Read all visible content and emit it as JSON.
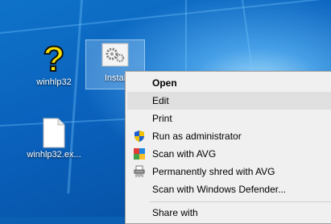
{
  "desktop": {
    "icons": [
      {
        "label": "winhlp32",
        "icon": "help-question-icon"
      },
      {
        "label": "Instal",
        "icon": "settings-gear-icon",
        "selected": true
      },
      {
        "label": "winhlp32.ex...",
        "icon": "blank-file-icon"
      }
    ]
  },
  "context_menu": {
    "items": [
      {
        "label": "Open",
        "bold": true
      },
      {
        "label": "Edit",
        "highlighted": true
      },
      {
        "label": "Print"
      },
      {
        "label": "Run as administrator",
        "icon": "uac-shield-icon"
      },
      {
        "label": "Scan with AVG",
        "icon": "avg-icon"
      },
      {
        "label": "Permanently shred with AVG",
        "icon": "shredder-icon"
      },
      {
        "label": "Scan with Windows Defender...",
        "icon": "windows-defender-icon"
      },
      {
        "label": "Share with"
      }
    ]
  },
  "colors": {
    "menu_background": "#f0f0f0",
    "highlight": "#e0e0e0",
    "wallpaper": "#0a62bd"
  }
}
